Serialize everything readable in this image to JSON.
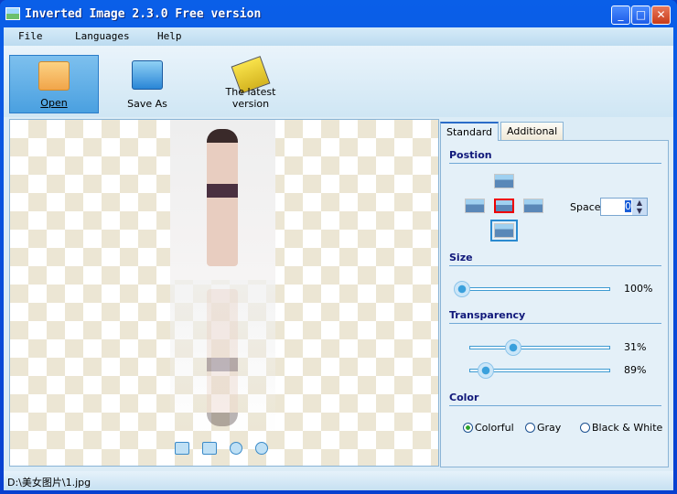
{
  "window": {
    "title": "Inverted Image 2.3.0 Free version",
    "controls": [
      "minimize",
      "maximize",
      "close"
    ]
  },
  "menu": [
    "File",
    "Languages",
    "Help"
  ],
  "toolbar": {
    "open": "Open",
    "save_as": "Save As",
    "latest": "The latest version"
  },
  "panel": {
    "tabs": [
      "Standard",
      "Additional"
    ],
    "position": {
      "title": "Postion",
      "space_label": "Space",
      "space_value": "0",
      "selected": "bottom"
    },
    "size": {
      "title": "Size",
      "value": 100,
      "label": "100%"
    },
    "transparency": {
      "title": "Transparency",
      "value1": 31,
      "label1": "31%",
      "value2": 89,
      "label2": "89%"
    },
    "color": {
      "title": "Color",
      "options": [
        "Colorful",
        "Gray",
        "Black & White"
      ],
      "selected": "Colorful"
    }
  },
  "status": "D:\\美女图片\\1.jpg"
}
